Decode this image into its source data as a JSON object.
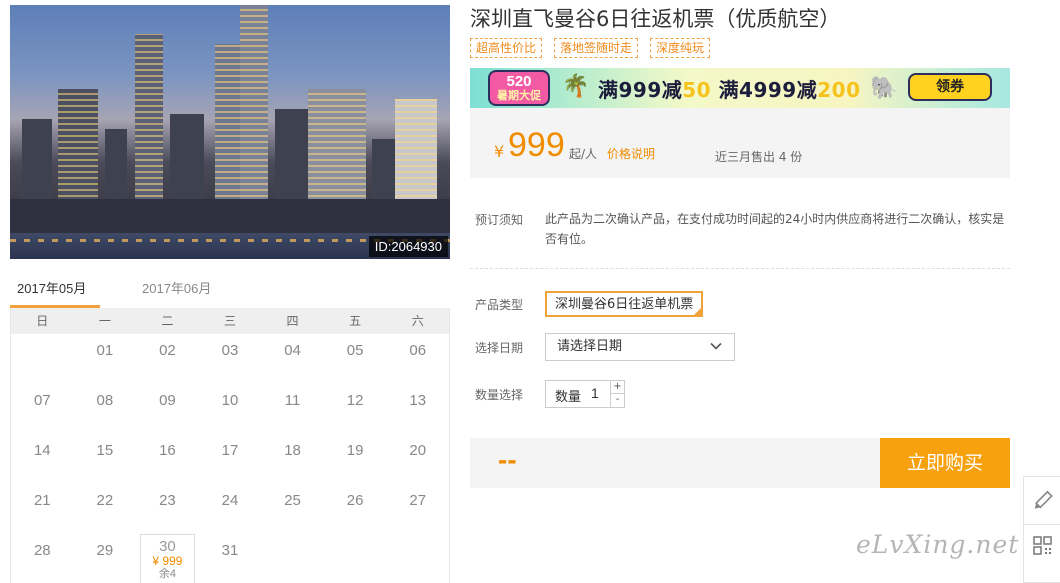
{
  "photo": {
    "id_label": "ID:2064930"
  },
  "calendar": {
    "tabs": [
      {
        "label": "2017年05月",
        "active": true
      },
      {
        "label": "2017年06月",
        "active": false
      }
    ],
    "weekdays": [
      "日",
      "一",
      "二",
      "三",
      "四",
      "五",
      "六"
    ],
    "days": [
      "",
      "01",
      "02",
      "03",
      "04",
      "05",
      "06",
      "07",
      "08",
      "09",
      "10",
      "11",
      "12",
      "13",
      "14",
      "15",
      "16",
      "17",
      "18",
      "19",
      "20",
      "21",
      "22",
      "23",
      "24",
      "25",
      "26",
      "27",
      "28",
      "29",
      "30",
      "31",
      "",
      "",
      ""
    ],
    "available": {
      "day": "30",
      "price": "¥ 999",
      "stock": "余4"
    }
  },
  "product": {
    "title": "深圳直飞曼谷6日往返机票（优质航空）",
    "tags": [
      "超高性价比",
      "落地签随时走",
      "深度纯玩"
    ]
  },
  "banner": {
    "badge_num": "520",
    "badge_text": "暑期大促",
    "deal_a": "满999减",
    "deal_a_num": "50",
    "deal_b": "满4999减",
    "deal_b_num": "200",
    "coupon_label": "领券"
  },
  "price": {
    "currency": "¥",
    "amount": "999",
    "unit": "起/人",
    "explain_link": "价格说明",
    "sold": "近三月售出 4 份"
  },
  "notice": {
    "label": "预订须知",
    "text": "此产品为二次确认产品，在支付成功时间起的24小时内供应商将进行二次确认，核实是否有位。"
  },
  "form": {
    "type_label": "产品类型",
    "type_value": "深圳曼谷6日往返单机票",
    "date_label": "选择日期",
    "date_placeholder": "请选择日期",
    "qty_label": "数量选择",
    "qty_inner_label": "数量",
    "qty_value": "1",
    "qty_up": "+",
    "qty_down": "-"
  },
  "buy": {
    "total": "--",
    "button": "立即购买"
  },
  "watermark": "eLvXing.net",
  "colors": {
    "accent": "#f08c00",
    "buy_button": "#f7a10e",
    "tag_border": "#f0a347"
  }
}
